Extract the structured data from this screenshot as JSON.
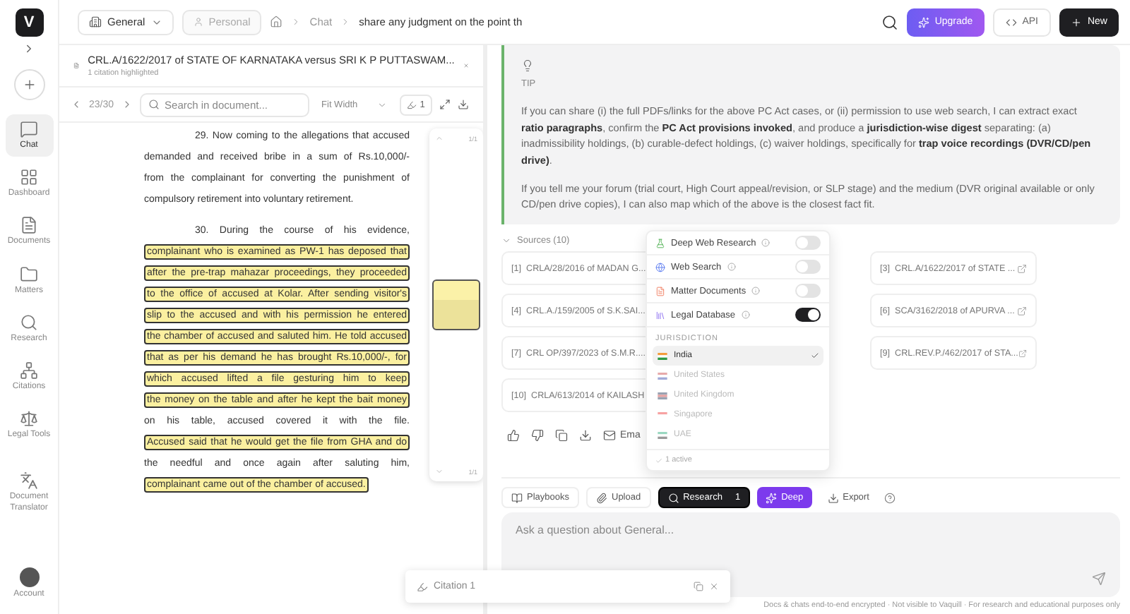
{
  "sidebar": {
    "logo": "V",
    "items": [
      {
        "label": "Chat",
        "kind": "chat",
        "selected": true
      },
      {
        "label": "Dashboard",
        "kind": "dashboard",
        "selected": false
      },
      {
        "label": "Documents",
        "kind": "documents",
        "selected": false
      },
      {
        "label": "Matters",
        "kind": "matters",
        "selected": false
      },
      {
        "label": "Research",
        "kind": "research",
        "selected": false
      },
      {
        "label": "Citations",
        "kind": "citations",
        "selected": false
      },
      {
        "label": "Legal Tools",
        "kind": "tools",
        "selected": false
      }
    ],
    "translator": "Document Translator",
    "account": "Account"
  },
  "topbar": {
    "workspace": "General",
    "scope": "Personal",
    "breadcrumb": [
      "Chat",
      "share any judgment on the point th"
    ],
    "buttons": [
      {
        "label": "Upgrade",
        "kind": "upgrade"
      },
      {
        "label": "API",
        "kind": "api"
      },
      {
        "label": "New",
        "kind": "new"
      }
    ]
  },
  "document": {
    "title": "CRL.A/1622/2017 of STATE OF KARNATAKA versus SRI K P PUTTASWAM...",
    "subtitle": "1 citation highlighted",
    "page": "23/30",
    "search": {
      "placeholder": "Search in document..."
    },
    "zoom": "Fit Width",
    "highlight_count": "1",
    "minimap": {
      "top": "1/1",
      "bottom": "1/1"
    },
    "lines": [
      {
        "text": "29. Now coming to the allegations that accused",
        "kind": "start",
        "highlighted": false
      },
      {
        "text": "demanded and received bribe in a sum of Rs.10,000/-",
        "kind": "line",
        "highlighted": false
      },
      {
        "text": "from the complainant for converting the punishment of",
        "kind": "line",
        "highlighted": false
      },
      {
        "text": "compulsory retirement into voluntary retirement.",
        "kind": "end",
        "highlighted": false
      },
      {
        "text": "30. During the course of his evidence,",
        "kind": "start",
        "highlighted": false
      },
      {
        "text": "complainant who is examined as PW-1 has deposed that",
        "kind": "line",
        "highlighted": true
      },
      {
        "text": "after the pre-trap mahazar proceedings, they proceeded",
        "kind": "line",
        "highlighted": true
      },
      {
        "text": "to the office of accused at Kolar. After sending visitor's",
        "kind": "line",
        "highlighted": true
      },
      {
        "text": "slip to the accused and with his permission he entered",
        "kind": "line",
        "highlighted": true
      },
      {
        "text": "the chamber of accused and saluted him. He told accused",
        "kind": "line",
        "highlighted": true
      },
      {
        "text": "that as per his demand he has brought Rs.10,000/-, for",
        "kind": "line",
        "highlighted": true
      },
      {
        "text": "which accused lifted a file gesturing him to keep",
        "kind": "line",
        "highlighted": true
      },
      {
        "text": "the money on the table and after he kept the bait money",
        "kind": "line",
        "highlighted": true
      },
      {
        "text": "on his table, accused covered it with the file.",
        "kind": "line",
        "highlighted": false
      },
      {
        "text": "Accused said that he would get the file from GHA and do",
        "kind": "line",
        "highlighted": true
      },
      {
        "text": "the needful and once again after saluting him,",
        "kind": "line",
        "highlighted": false
      },
      {
        "text": "complainant came out of the chamber of accused.",
        "kind": "end",
        "highlighted": true
      }
    ]
  },
  "tip": {
    "label": "TIP",
    "paragraphs": [
      "If you can share (i) the full PDFs/links for the above PC Act cases, or (ii) permission to use web search, I can extract exact **ratio paragraphs**, confirm the **PC Act provisions invoked**, and produce a **jurisdiction-wise digest** separating: (a) inadmissibility holdings, (b) curable-defect holdings, (c) waiver holdings, specifically for **trap voice recordings (DVR/CD/pen drive)**.",
      "If you tell me your forum (trial court, High Court appeal/revision, or SLP stage) and the medium (DVR original available or only CD/pen drive copies), I can also map which of the above is the closest fact fit."
    ]
  },
  "sources": {
    "title": "Sources (10)",
    "rows": [
      {
        "left": {
          "ref": "[1]",
          "label": "CRLA/28/2016 of MADAN G..."
        },
        "right": {
          "ref": "[3]",
          "label": "CRL.A/1622/2017 of STATE ..."
        }
      },
      {
        "left": {
          "ref": "[4]",
          "label": "CRL.A./159/2005 of S.K.SAI..."
        },
        "right": {
          "ref": "[6]",
          "label": "SCA/3162/2018 of APURVA ..."
        }
      },
      {
        "left": {
          "ref": "[7]",
          "label": "CRL OP/397/2023 of S.M.R...."
        },
        "right": {
          "ref": "[9]",
          "label": "CRL.REV.P./462/2017 of STA..."
        }
      },
      {
        "left": {
          "ref": "[10]",
          "label": "CRLA/613/2014 of KAILASH"
        }
      }
    ]
  },
  "actions": {
    "email": "Ema"
  },
  "menu": {
    "options": [
      {
        "label": "Deep Web Research",
        "kind": "deep",
        "on": false
      },
      {
        "label": "Web Search",
        "kind": "web",
        "on": false
      },
      {
        "label": "Matter Documents",
        "kind": "matter",
        "on": false
      },
      {
        "label": "Legal Database",
        "kind": "legal",
        "on": true
      }
    ],
    "jurisdiction_title": "JURISDICTION",
    "jurisdictions": [
      {
        "label": "India",
        "kind": "in",
        "selected": true
      },
      {
        "label": "United States",
        "kind": "us",
        "selected": false
      },
      {
        "label": "United Kingdom",
        "kind": "uk",
        "selected": false
      },
      {
        "label": "Singapore",
        "kind": "sg",
        "selected": false
      },
      {
        "label": "UAE",
        "kind": "ae",
        "selected": false
      }
    ],
    "footer": "1 active"
  },
  "composer": {
    "tools": [
      {
        "label": "Playbooks",
        "kind": "playbooks"
      },
      {
        "label": "Upload",
        "kind": "upload"
      },
      {
        "label": "Research",
        "kind": "research",
        "count": "1"
      },
      {
        "label": "Deep",
        "kind": "deep"
      },
      {
        "label": "Export",
        "kind": "export"
      }
    ],
    "placeholder": "Ask a question about General...",
    "footer": "Docs & chats end-to-end encrypted · Not visible to Vaquill · For research and educational purposes only"
  },
  "citation_popup": {
    "label": "Citation 1"
  }
}
